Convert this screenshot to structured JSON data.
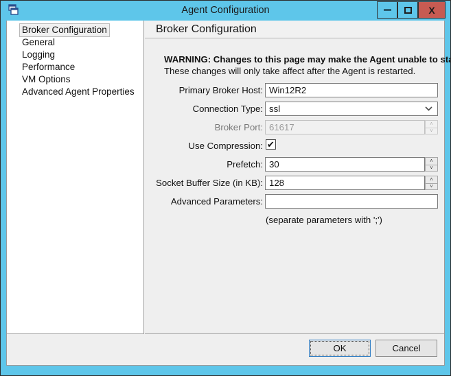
{
  "window": {
    "title": "Agent Configuration",
    "icon": "cascade-windows-icon",
    "controls": {
      "minimize_label": "–",
      "maximize_label": "□",
      "close_label": "X"
    },
    "colors": {
      "frame": "#5ec6ea",
      "close_button": "#c75b52",
      "client": "#efefef",
      "focus_border": "#2f7dc4"
    }
  },
  "sidebar": {
    "items": [
      {
        "label": "Broker Configuration",
        "selected": true
      },
      {
        "label": "General",
        "selected": false
      },
      {
        "label": "Logging",
        "selected": false
      },
      {
        "label": "Performance",
        "selected": false
      },
      {
        "label": "VM Options",
        "selected": false
      },
      {
        "label": "Advanced Agent Properties",
        "selected": false
      }
    ]
  },
  "pane": {
    "title": "Broker Configuration",
    "warning_bold": "WARNING: Changes to this page may make the Agent unable to start.",
    "warning_text": "These changes will only take affect after the Agent is restarted.",
    "hint": "(separate parameters with ';')",
    "fields": {
      "primary_broker_host": {
        "label": "Primary Broker Host:",
        "value": "Win12R2",
        "placeholder": ""
      },
      "connection_type": {
        "label": "Connection Type:",
        "value": "ssl",
        "arrow": "⌄",
        "options": [
          "ssl"
        ]
      },
      "broker_port": {
        "label": "Broker Port:",
        "value": "61617",
        "disabled": true
      },
      "use_compression": {
        "label": "Use Compression:",
        "checked": true,
        "check_glyph": "✔"
      },
      "prefetch": {
        "label": "Prefetch:",
        "value": "30"
      },
      "socket_buffer_size": {
        "label": "Socket Buffer Size (in KB):",
        "value": "128"
      },
      "advanced_parameters": {
        "label": "Advanced Parameters:",
        "value": "",
        "placeholder": ""
      }
    },
    "spinner": {
      "up": "˄",
      "down": "˅"
    }
  },
  "footer": {
    "ok_label": "OK",
    "cancel_label": "Cancel"
  }
}
